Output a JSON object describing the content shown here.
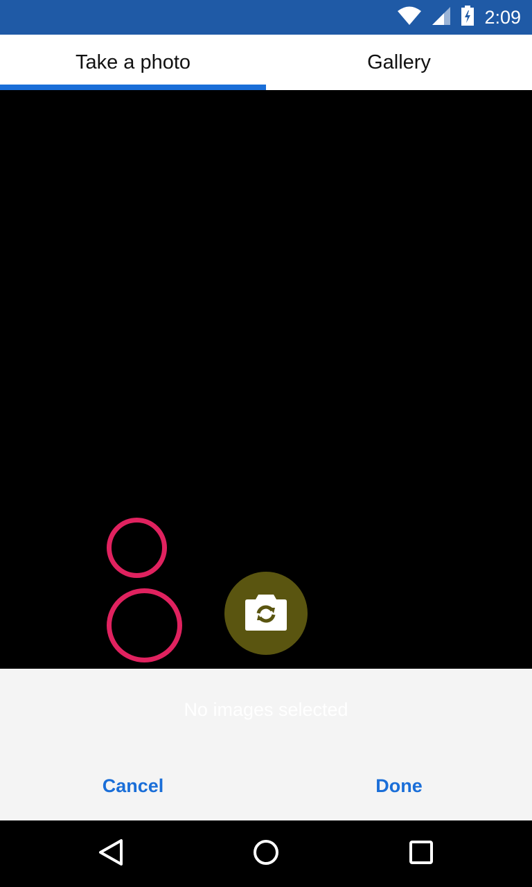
{
  "status_bar": {
    "time": "2:09",
    "icons": [
      "wifi-icon",
      "cell-signal-icon",
      "battery-charging-icon"
    ],
    "background": "#1f5aa6"
  },
  "tabs": [
    {
      "label": "Take a photo",
      "active": true
    },
    {
      "label": "Gallery",
      "active": false
    }
  ],
  "camera": {
    "switch_icon": "camera-switch-icon",
    "switch_button_color": "#5a5510",
    "ring_color": "#e0225f"
  },
  "selection": {
    "empty_message": "No images selected"
  },
  "actions": {
    "cancel_label": "Cancel",
    "done_label": "Done",
    "color": "#1a6ed8"
  },
  "nav_bar": {
    "icons": [
      "back-icon",
      "home-icon",
      "recents-icon"
    ]
  }
}
